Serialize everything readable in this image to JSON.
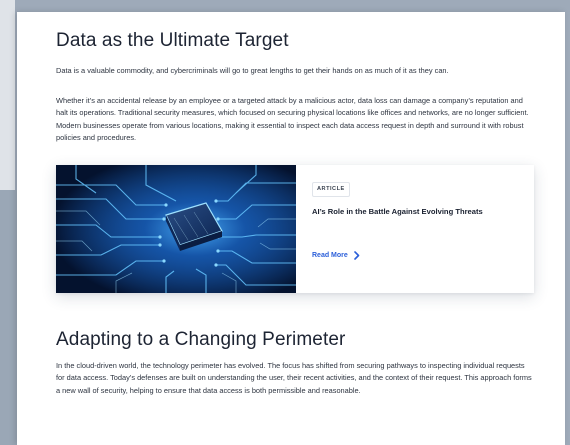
{
  "section1": {
    "title": "Data as the Ultimate Target",
    "intro": "Data is a valuable commodity, and cybercriminals will go to great lengths to get their hands on as much of it as they can.",
    "body": "Whether it’s an accidental release by an employee or a targeted attack by a malicious actor, data loss can damage a company’s reputation and halt its operations. Traditional security measures, which focused on securing physical locations like offices and networks, are no longer sufficient. Modern businesses operate from various locations, making it essential to inspect each data access request in depth and surround it with robust policies and procedures."
  },
  "card": {
    "image": "circuit-board-chip-image",
    "badge": "ARTICLE",
    "title": "AI’s Role in the Battle Against Evolving Threats",
    "read_more": "Read More",
    "read_more_icon": "chevron-right-icon",
    "accent": "#2b5fd9"
  },
  "section2": {
    "title": "Adapting to a Changing Perimeter",
    "body": "In the cloud-driven world, the technology perimeter has evolved. The focus has shifted from securing pathways to inspecting individual requests for data access. Today’s defenses are built on understanding the user, their recent activities, and the context of their request. This approach forms a new wall of security, helping to ensure that data access is both permissible and reasonable."
  },
  "colors": {
    "heading": "#1d2433",
    "text": "#2d3440",
    "frame": "#9fabba"
  }
}
